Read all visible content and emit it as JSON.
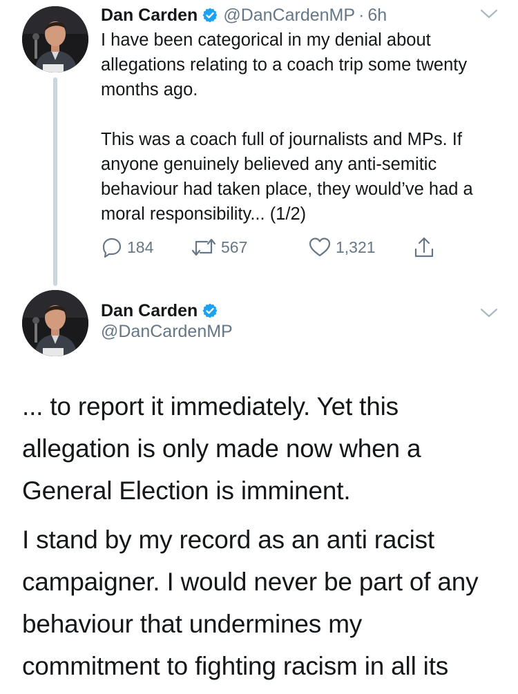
{
  "tweet1": {
    "author_name": "Dan Carden",
    "handle": "@DanCardenMP",
    "separator": "·",
    "time": "6h",
    "text": "I have been categorical in my denial about allegations relating to a coach trip some twenty months ago.\n\nThis was a coach full of journalists and MPs. If anyone genuinely believed any anti-semitic behaviour had taken place, they would’ve had a moral responsibility... (1/2)",
    "reply_count": "184",
    "retweet_count": "567",
    "like_count": "1,321",
    "icons": {
      "reply": "reply-icon",
      "retweet": "retweet-icon",
      "like": "heart-icon",
      "share": "share-icon",
      "verified": "verified-badge-icon",
      "menu": "chevron-down-icon"
    }
  },
  "tweet2": {
    "author_name": "Dan Carden",
    "handle": "@DanCardenMP",
    "paragraphs": [
      "... to report it immediately. Yet this allegation is only made now when a General Election is imminent.",
      "I stand by my record as an anti racist campaigner. I would never be part of any behaviour that undermines my commitment to fighting racism in all its"
    ]
  },
  "colors": {
    "text": "#14171a",
    "secondary": "#657786",
    "verified": "#1da1f2",
    "thread_line": "#ccd6dd"
  }
}
